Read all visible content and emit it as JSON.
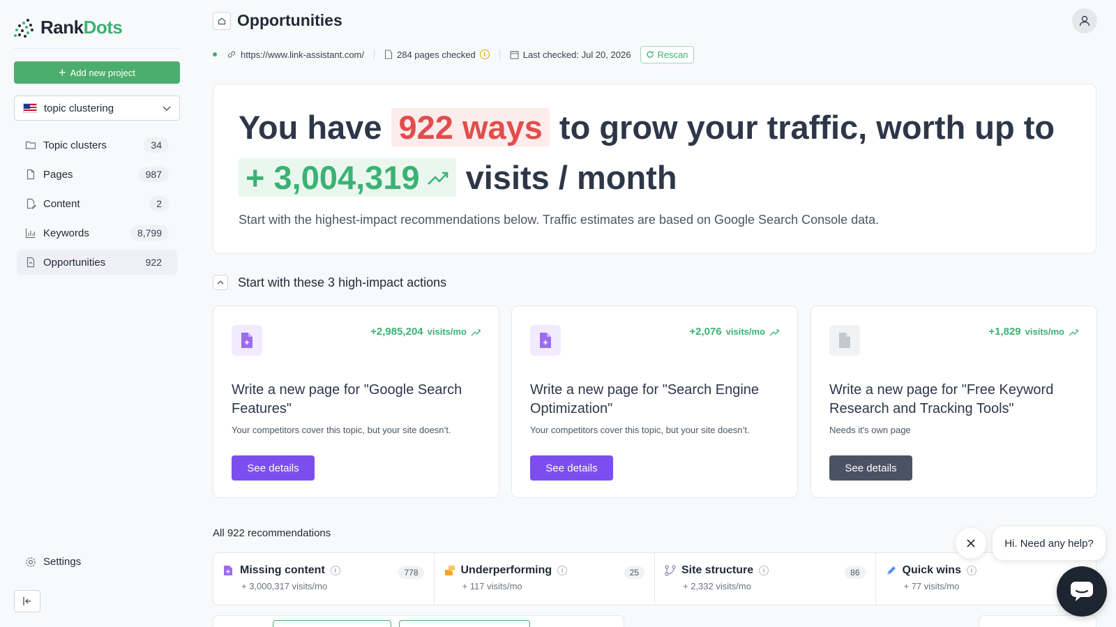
{
  "app": {
    "name_part1": "Rank",
    "name_part2": "Dots",
    "brand_color": "#3bb273"
  },
  "sidebar": {
    "add_project_label": "Add new project",
    "project_selector": {
      "value": "topic clustering",
      "flag": "us-flag"
    },
    "items": [
      {
        "label": "Topic clusters",
        "count": "34",
        "icon": "folder-icon"
      },
      {
        "label": "Pages",
        "count": "987",
        "icon": "file-icon"
      },
      {
        "label": "Content",
        "count": "2",
        "icon": "edit-file-icon"
      },
      {
        "label": "Keywords",
        "count": "8,799",
        "icon": "bar-chart-icon"
      },
      {
        "label": "Opportunities",
        "count": "922",
        "icon": "opportunity-file-icon",
        "active": true
      }
    ],
    "settings_label": "Settings"
  },
  "header": {
    "title": "Opportunities",
    "url": "https://www.link-assistant.com/",
    "pages_checked": "284 pages checked",
    "last_checked": "Last checked: Jul 20, 2026",
    "rescan_label": "Rescan"
  },
  "hero": {
    "prefix": "You have",
    "ways": "922 ways",
    "middle": "to grow your traffic, worth up to",
    "visits_value": "+ 3,004,319",
    "visits_suffix": "visits / month",
    "subtitle": "Start with the highest-impact recommendations below. Traffic estimates are based on Google Search Console data."
  },
  "actions_section": {
    "title": "Start with these 3 high-impact actions",
    "cards": [
      {
        "impact": "+2,985,204",
        "unit": "visits/mo",
        "title": "Write a new page for \"Google Search Features\"",
        "description": "Your competitors cover this topic, but your site doesn’t.",
        "button": "See details"
      },
      {
        "impact": "+2,076",
        "unit": "visits/mo",
        "title": "Write a new page for \"Search Engine Optimization\"",
        "description": "Your competitors cover this topic, but your site doesn’t.",
        "button": "See details"
      },
      {
        "impact": "+1,829",
        "unit": "visits/mo",
        "title": "Write a new page for \"Free Keyword Research and Tracking Tools\"",
        "description": "Needs it's own page",
        "button": "See details"
      }
    ]
  },
  "recommendations": {
    "title": "All 922 recommendations",
    "categories": [
      {
        "label": "Missing content",
        "count": "778",
        "visits": "+ 3,000,317",
        "unit": "visits/mo"
      },
      {
        "label": "Underperforming",
        "count": "25",
        "visits": "+ 117",
        "unit": "visits/mo"
      },
      {
        "label": "Site structure",
        "count": "86",
        "visits": "+ 2,332",
        "unit": "visits/mo"
      },
      {
        "label": "Quick wins",
        "count": "",
        "visits": "+ 77",
        "unit": "visits/mo"
      }
    ]
  },
  "chat": {
    "greeting": "Hi. Need any help?"
  }
}
